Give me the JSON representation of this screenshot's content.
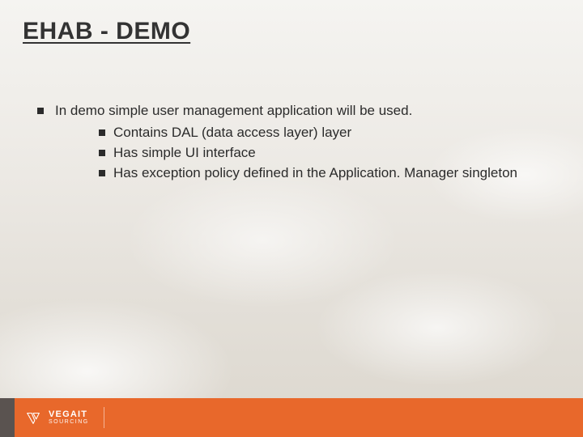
{
  "title": "EHAB - DEMO",
  "bullets": {
    "main": "In demo simple user management application will be used.",
    "subs": [
      "Contains DAL (data access layer) layer",
      "Has simple UI interface",
      "Has exception policy defined in the Application. Manager singleton"
    ]
  },
  "footer": {
    "brand_main": "VEGAIT",
    "brand_sub": "SOURCING"
  }
}
